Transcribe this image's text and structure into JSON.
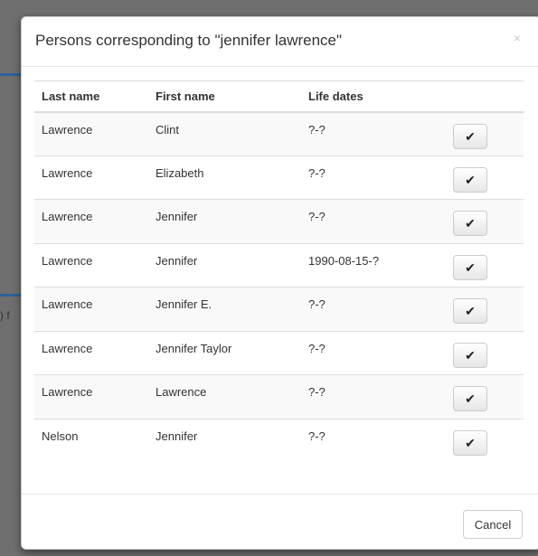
{
  "background": {
    "partial_text": ") f"
  },
  "modal": {
    "title": "Persons corresponding to \"jennifer lawrence\"",
    "close_label": "×",
    "columns": [
      "Last name",
      "First name",
      "Life dates",
      ""
    ],
    "rows": [
      {
        "last": "Lawrence",
        "first": "Clint",
        "dates": "?-?",
        "action": "✔"
      },
      {
        "last": "Lawrence",
        "first": "Elizabeth",
        "dates": "?-?",
        "action": "✔"
      },
      {
        "last": "Lawrence",
        "first": "Jennifer",
        "dates": "?-?",
        "action": "✔"
      },
      {
        "last": "Lawrence",
        "first": "Jennifer",
        "dates": "1990-08-15-?",
        "action": "✔"
      },
      {
        "last": "Lawrence",
        "first": "Jennifer E.",
        "dates": "?-?",
        "action": "✔"
      },
      {
        "last": "Lawrence",
        "first": "Jennifer Taylor",
        "dates": "?-?",
        "action": "✔"
      },
      {
        "last": "Lawrence",
        "first": "Lawrence",
        "dates": "?-?",
        "action": "✔"
      },
      {
        "last": "Nelson",
        "first": "Jennifer",
        "dates": "?-?",
        "action": "✔"
      }
    ],
    "cancel_label": "Cancel"
  },
  "icons": {
    "select": "check-icon",
    "close": "close-icon"
  },
  "colors": {
    "backdrop": "#6f6f6f",
    "stripe": "#f9f9f9",
    "border": "#dddddd"
  }
}
